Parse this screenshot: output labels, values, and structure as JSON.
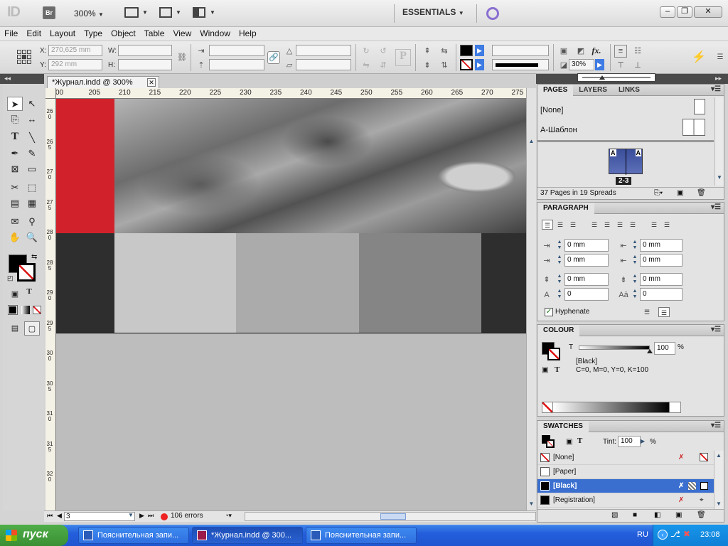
{
  "appbar": {
    "logo": "ID",
    "bridge": "Br",
    "zoom": "300%",
    "workspace": "ESSENTIALS",
    "win_min": "–",
    "win_max": "❐",
    "win_close": "✕"
  },
  "menu": [
    "File",
    "Edit",
    "Layout",
    "Type",
    "Object",
    "Table",
    "View",
    "Window",
    "Help"
  ],
  "control": {
    "x_label": "X:",
    "x_value": "270,625 mm",
    "y_label": "Y:",
    "y_value": "292 mm",
    "w_label": "W:",
    "h_label": "H:",
    "stroke_pct": "30%"
  },
  "document": {
    "tab_title": "*Журнал.indd @ 300%",
    "ruler_top": [
      "00",
      "205",
      "210",
      "215",
      "220",
      "225",
      "230",
      "235",
      "240",
      "245",
      "250",
      "255",
      "260",
      "265",
      "270",
      "275"
    ],
    "ruler_left": [
      "260",
      "265",
      "270",
      "275",
      "280",
      "285",
      "290",
      "295",
      "300",
      "305",
      "310",
      "315",
      "320"
    ],
    "page_number": "3",
    "errors": "106 errors"
  },
  "pages_panel": {
    "tabs": [
      "PAGES",
      "LAYERS",
      "LINKS"
    ],
    "master_none": "[None]",
    "master_a": "А-Шаблон",
    "spread_label": "2-3",
    "spread_master": "A",
    "summary": "37 Pages in 19 Spreads"
  },
  "paragraph_panel": {
    "title": "PARAGRAPH",
    "left_indent": "0 mm",
    "right_indent": "0 mm",
    "first_indent": "0 mm",
    "last_indent": "0 mm",
    "space_before": "0 mm",
    "space_after": "0 mm",
    "drop_lines": "0",
    "drop_chars": "0",
    "hyphenate": "Hyphenate"
  },
  "colour_panel": {
    "title": "COLOUR",
    "tint_label": "T",
    "tint_value": "100",
    "pct": "%",
    "swatch_name": "[Black]",
    "cmyk": "C=0, M=0, Y=0, K=100"
  },
  "swatches_panel": {
    "title": "SWATCHES",
    "tint_label": "Tint:",
    "tint_value": "100",
    "pct": "%",
    "items": [
      {
        "name": "[None]",
        "color": "#ffffff"
      },
      {
        "name": "[Paper]",
        "color": "#ffffff"
      },
      {
        "name": "[Black]",
        "color": "#000000"
      },
      {
        "name": "[Registration]",
        "color": "#000000"
      }
    ]
  },
  "taskbar": {
    "start": "пуск",
    "tasks": [
      "Пояснительная запи...",
      "*Журнал.indd @ 300...",
      "Пояснительная запи..."
    ],
    "lang": "RU",
    "clock": "23:08"
  },
  "colors": {
    "red_block": "#d1222b",
    "dark_block": "#2e2e2e",
    "selection": "#3a6fd0"
  }
}
